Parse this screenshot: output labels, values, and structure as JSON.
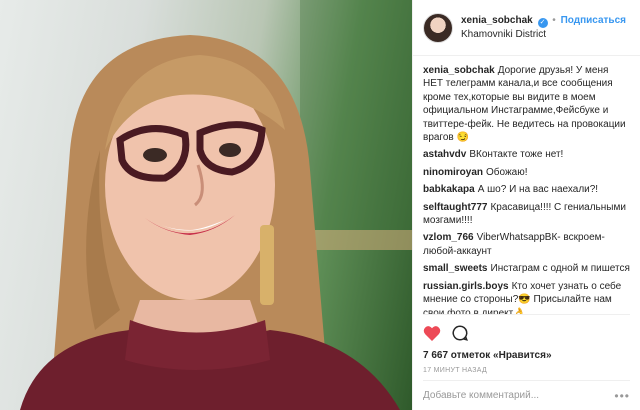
{
  "header": {
    "username": "xenia_sobchak",
    "follow_label": "Подписаться",
    "location": "Khamovniki District"
  },
  "comments": [
    {
      "user": "xenia_sobchak",
      "text": "Дорогие друзья! У меня НЕТ телеграмм канала,и все сообщения кроме тех,которые вы видите в моем официальном Инстаграмме,Фейсбуке и твиттере-фейк. Не ведитесь на провокации врагов 😏"
    },
    {
      "user": "astahvdv",
      "text": "ВКонтакте тоже нет!"
    },
    {
      "user": "ninomiroyan",
      "text": "Обожаю!"
    },
    {
      "user": "babkakapa",
      "text": "А шо? И на вас наехали?!"
    },
    {
      "user": "selftaught777",
      "text": "Красавица!!!! С гениальными мозгами!!!!"
    },
    {
      "user": "vzlom_766",
      "text": "ViberWhatsappВК- вскроем-любой-аккаунт"
    },
    {
      "user": "small_sweets",
      "text": "Инстаграм с одной м пишется"
    },
    {
      "user": "russian.girls.boys",
      "text": "Кто хочет узнать о себе мнение со стороны?😎 Присылайте нам свои фото в директ👌"
    }
  ],
  "likes_text": "7 667 отметок «Нравится»",
  "timestamp": "17 минут назад",
  "comment_input": {
    "placeholder": "Добавьте комментарий..."
  },
  "icons": {
    "like": "heart-icon",
    "comment": "comment-bubble-icon",
    "verified": "verified-badge-icon",
    "more": "more-options-icon"
  },
  "colors": {
    "accent": "#3897f0",
    "heart": "#ed4956"
  }
}
